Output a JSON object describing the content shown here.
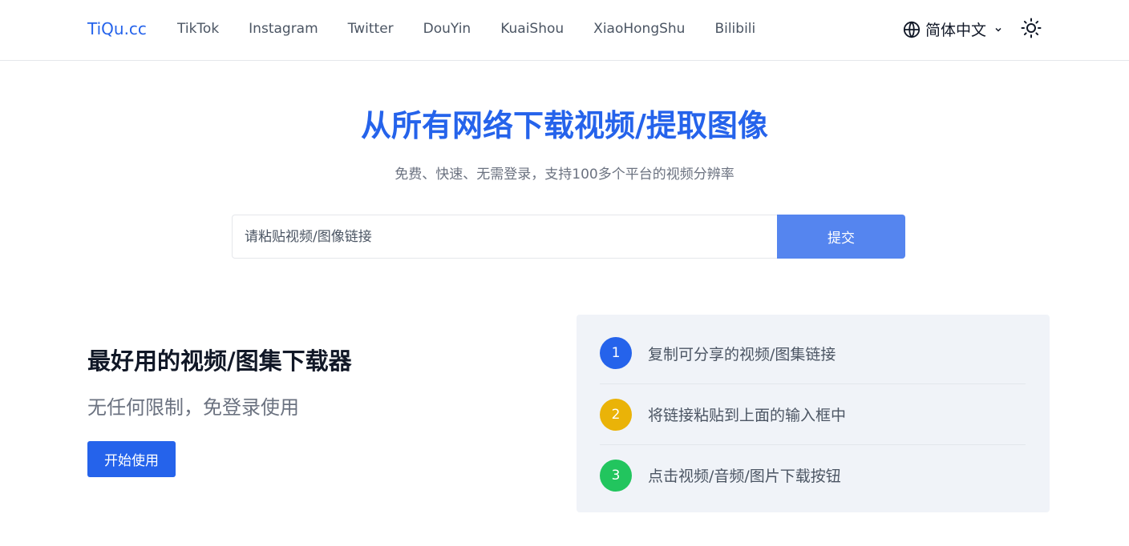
{
  "header": {
    "logo": "TiQu.cc",
    "nav": [
      "TikTok",
      "Instagram",
      "Twitter",
      "DouYin",
      "KuaiShou",
      "XiaoHongShu",
      "Bilibili"
    ],
    "language": "简体中文",
    "icons": {
      "language": "globe-icon",
      "dropdown": "chevron-down-icon",
      "theme": "sun-icon"
    }
  },
  "hero": {
    "title": "从所有网络下载视频/提取图像",
    "subtitle": "免费、快速、无需登录，支持100多个平台的视频分辨率",
    "input_placeholder": "请粘贴视频/图像链接",
    "input_value": "",
    "submit_label": "提交"
  },
  "feature": {
    "title": "最好用的视频/图集下载器",
    "subtitle": "无任何限制，免登录使用",
    "start_label": "开始使用"
  },
  "steps": [
    {
      "number": "1",
      "text": "复制可分享的视频/图集链接",
      "color": "#2563eb"
    },
    {
      "number": "2",
      "text": "将链接粘贴到上面的输入框中",
      "color": "#eab308"
    },
    {
      "number": "3",
      "text": "点击视频/音频/图片下载按钮",
      "color": "#22c55e"
    }
  ],
  "colors": {
    "brand": "#2563eb",
    "submit_button": "#5585ef",
    "steps_panel": "#f0f3f8"
  }
}
